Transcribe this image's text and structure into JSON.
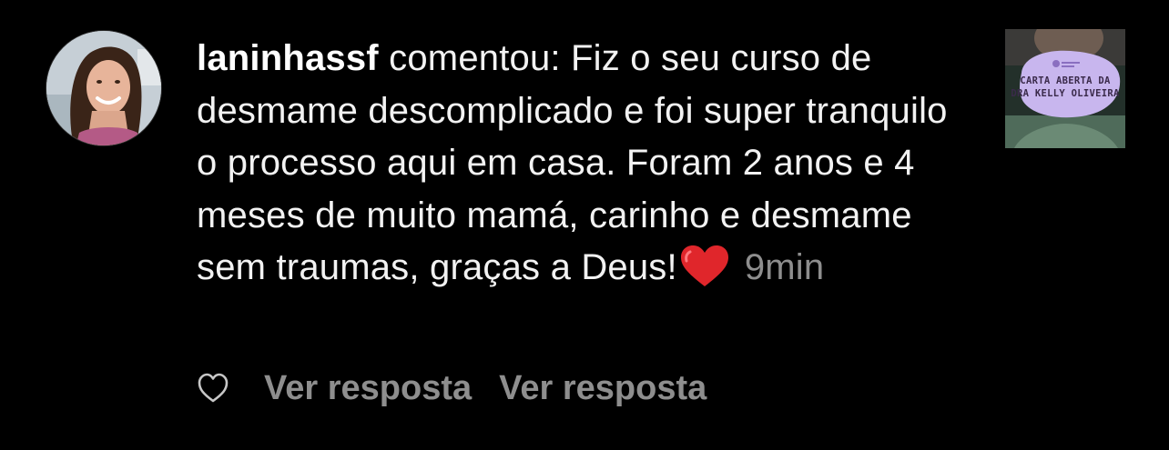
{
  "comment": {
    "username": "laninhassf",
    "text": " comentou: Fiz o seu curso de desmame descomplicado e foi super tranquilo o processo aqui em casa. Foram 2 anos e 4 meses de muito mamá, carinho e desmame sem traumas, graças a Deus!",
    "emoji": "heart-emoji",
    "timestamp": "9min"
  },
  "actions": {
    "like_icon": "heart-outline-icon",
    "reply_label_1": "Ver resposta",
    "reply_label_2": "Ver resposta"
  },
  "post_thumbnail": {
    "line1": "CARTA ABERTA DA",
    "line2": "DRA KELLY OLIVEIRA"
  },
  "colors": {
    "background": "#000000",
    "text": "#f2f2f2",
    "muted": "#8e8e8e",
    "heart": "#e0262b",
    "thumb_blob": "#c8b6ee"
  }
}
